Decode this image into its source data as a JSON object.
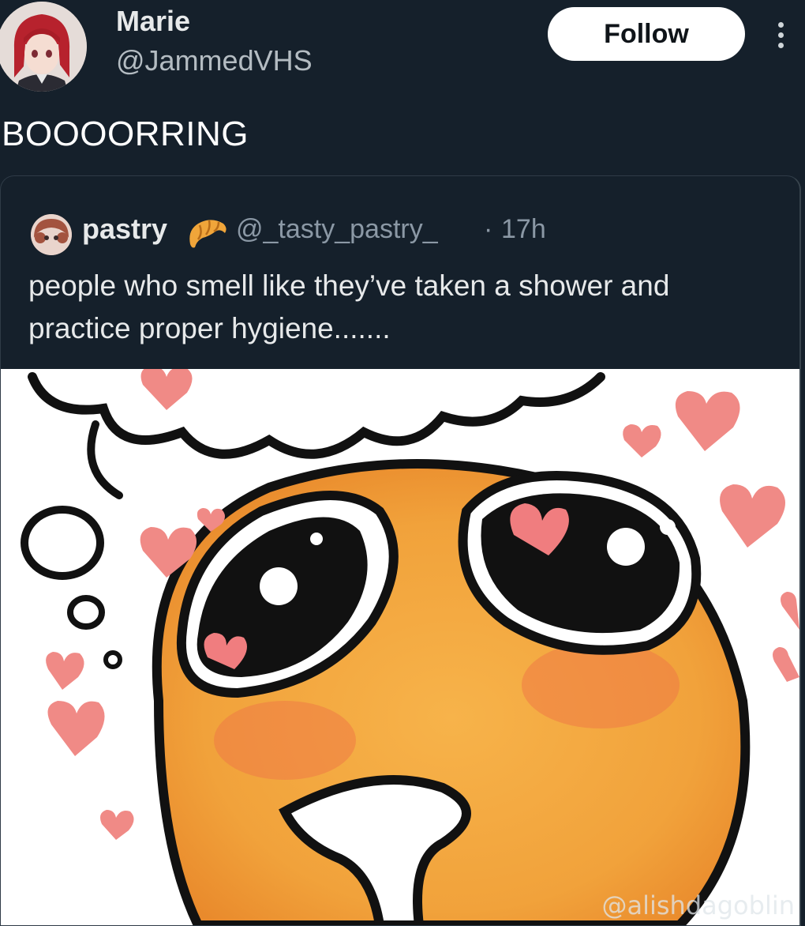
{
  "author": {
    "name": "Marie",
    "handle": "@JammedVHS",
    "follow_label": "Follow",
    "more_icon": "more-vertical-icon"
  },
  "tweet": {
    "text": "BOOOORRING"
  },
  "quoted_tweet": {
    "name": "pastry",
    "emoji_icon": "croissant-icon",
    "handle": "@_tasty_pastry_",
    "separator": "·",
    "time": "17h",
    "text": "people who smell like they’ve taken a shower and practice proper hygiene......."
  },
  "media": {
    "watermark": "@alishdagoblin"
  },
  "colors": {
    "background": "#15202b",
    "follow_button": "#ffffff",
    "secondary_text": "#8b98a5"
  }
}
